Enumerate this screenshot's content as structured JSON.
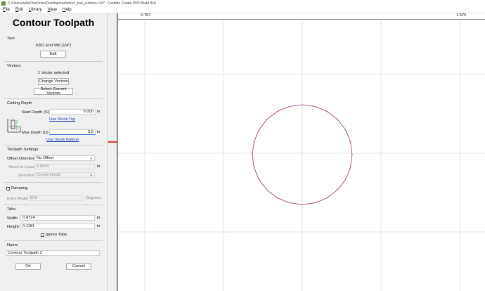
{
  "window": {
    "title": "C:/Users/willa/OneDrive/Desktop/carbide/cf_tool_outlines.c2d* - Carbide Create PRO Build 816"
  },
  "menu": {
    "items": [
      "File",
      "Edit",
      "Library",
      "View",
      "Help"
    ]
  },
  "panel": {
    "title": "Contour Toolpath",
    "tool": {
      "heading": "Tool",
      "name": "#201 End Mill (1/4\")",
      "edit_label": "Edit"
    },
    "vectors": {
      "heading": "Vectors",
      "status": "1 Vector selected",
      "change_label": "Change Vectors",
      "select_label": "Select Current Vectors"
    },
    "cutting_depth": {
      "heading": "Cutting Depth",
      "start_label": "Start Depth (S)",
      "start_value": "0.000",
      "start_unit": "in",
      "use_stock_top": "Use Stock Top",
      "max_label": "Max Depth (D)",
      "max_value": "0.5",
      "max_unit": "in",
      "use_stock_bottom": "Use Stock Bottom"
    },
    "toolpath_settings": {
      "heading": "Toolpath Settings",
      "offset_label": "Offset Direction",
      "offset_value": "No Offset",
      "stock_label": "Stock to Leave",
      "stock_value": "0.0000",
      "stock_unit": "in",
      "direction_label": "Direction",
      "direction_value": "Conventional"
    },
    "ramping": {
      "label": "Ramping",
      "entry_label": "Entry Angle",
      "entry_value": "20.0",
      "entry_unit": "Degrees"
    },
    "tabs": {
      "heading": "Tabs",
      "width_label": "Width",
      "width_value": "0.4724",
      "width_unit": "in",
      "height_label": "Height",
      "height_value": "0.1181",
      "height_unit": "in",
      "ignore_label": "Ignore Tabs"
    },
    "name": {
      "heading": "Name",
      "value": "Contour Toolpath 2"
    },
    "ok_label": "Ok",
    "cancel_label": "Cancel"
  },
  "canvas": {
    "ruler_labels": [
      "0.787",
      "1.575"
    ],
    "grid_color": "#cccccc",
    "toolpath_color": "#e03040",
    "vector_color": "#4055c8"
  }
}
